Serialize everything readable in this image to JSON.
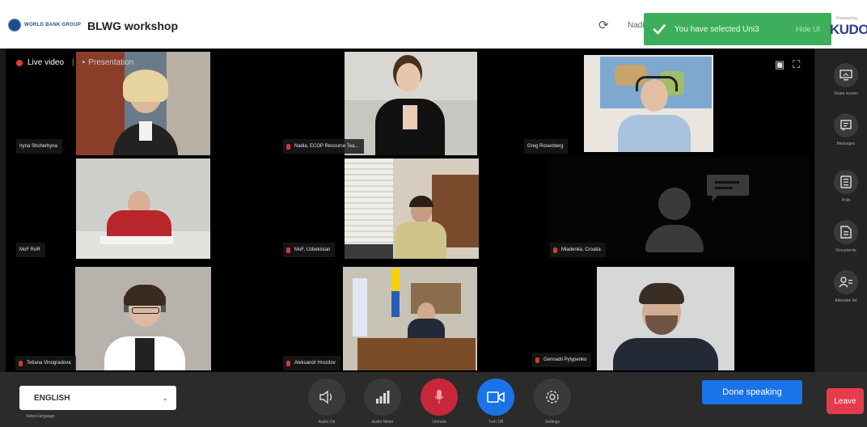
{
  "header": {
    "logo_text": "WORLD BANK GROUP",
    "title": "BLWG workshop",
    "user_name": "Nadi",
    "toast_text": "You have selected Uni3",
    "toast_action": "Hide UI",
    "powered_by": "Powered by",
    "brand": "KUDO"
  },
  "stage": {
    "live_label": "Live video",
    "presentation_label": "Presentation",
    "participants": [
      {
        "name": "Iryna Shcherbyna",
        "muted": false
      },
      {
        "name": "Nadia, ECOP Resource Tea...",
        "muted": true
      },
      {
        "name": "Greg Rosenberg",
        "muted": false
      },
      {
        "name": "MoF RoR",
        "muted": false
      },
      {
        "name": "MoF, Uzbekistan",
        "muted": true
      },
      {
        "name": "Mladenka, Croatia",
        "muted": true
      },
      {
        "name": "Tetiana Vinogradova",
        "muted": true
      },
      {
        "name": "Aleksandr Hrozdov",
        "muted": true
      },
      {
        "name": "Gennadii Pylypenko",
        "muted": true
      }
    ]
  },
  "sidebar": {
    "items": [
      {
        "label": "Share screen",
        "icon": "share-screen-icon"
      },
      {
        "label": "Messages",
        "icon": "messages-icon"
      },
      {
        "label": "Polls",
        "icon": "polls-icon"
      },
      {
        "label": "Documents",
        "icon": "documents-icon"
      },
      {
        "label": "Attendee list",
        "icon": "attendee-list-icon"
      }
    ]
  },
  "bottom": {
    "language": "ENGLISH",
    "language_hint": "Select language",
    "controls": [
      {
        "label": "Audio On",
        "icon": "speaker-icon"
      },
      {
        "label": "Audio Meter",
        "icon": "signal-bars-icon"
      },
      {
        "label": "Unmute",
        "icon": "microphone-muted-icon"
      },
      {
        "label": "Turn Off",
        "icon": "camera-icon"
      },
      {
        "label": "Settings",
        "icon": "gear-icon"
      }
    ],
    "done_speaking": "Done speaking",
    "leave": "Leave"
  },
  "colors": {
    "accent_blue": "#1a73e8",
    "toast_green": "#3fae5c",
    "leave_red": "#e53b4b",
    "mute_red": "#c8273a"
  }
}
